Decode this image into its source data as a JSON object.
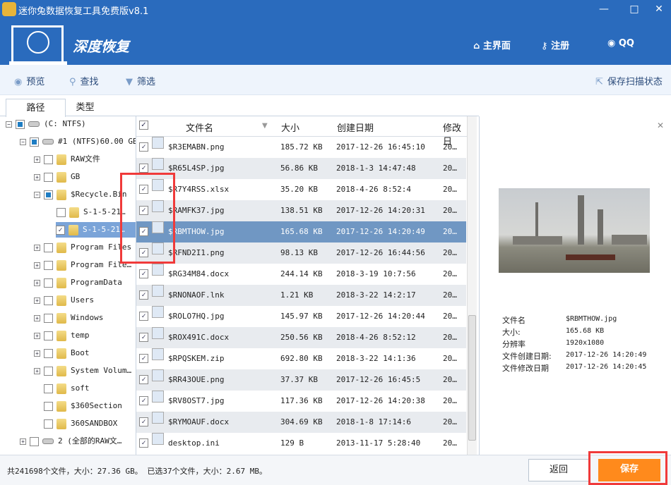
{
  "window": {
    "title": "迷你兔数据恢复工具免费版v8.1",
    "minimize": "—",
    "maximize": "□",
    "close": "✕"
  },
  "header": {
    "mode": "深度恢复",
    "nav": [
      {
        "icon": "home-icon",
        "glyph": "⌂",
        "label": "主界面"
      },
      {
        "icon": "key-icon",
        "glyph": "⚷",
        "label": "注册"
      },
      {
        "icon": "qq-icon",
        "glyph": "◉",
        "label": "QQ"
      }
    ]
  },
  "toolbar": {
    "preview": "预览",
    "find": "查找",
    "filter": "筛选",
    "save_scan": "保存扫描状态"
  },
  "tabs": [
    "路径",
    "类型"
  ],
  "tree": [
    {
      "label": "(C: NTFS)",
      "level": 0,
      "pm": "−",
      "cb": "part",
      "icon": "drive"
    },
    {
      "label": "#1 (NTFS)60.00 GB",
      "level": 1,
      "pm": "−",
      "cb": "part",
      "icon": "drive"
    },
    {
      "label": "RAW文件",
      "level": 2,
      "pm": "+",
      "cb": "",
      "icon": "folder"
    },
    {
      "label": "GB",
      "level": 2,
      "pm": "+",
      "cb": "",
      "icon": "folder"
    },
    {
      "label": "$Recycle.Bin",
      "level": 2,
      "pm": "−",
      "cb": "part",
      "icon": "folder"
    },
    {
      "label": "S-1-5-21…",
      "level": 3,
      "pm": "",
      "cb": "",
      "icon": "folder"
    },
    {
      "label": "S-1-5-21…",
      "level": 3,
      "pm": "",
      "cb": "✓",
      "icon": "folder",
      "selected": true
    },
    {
      "label": "Program Files",
      "level": 2,
      "pm": "+",
      "cb": "",
      "icon": "folder"
    },
    {
      "label": "Program File…",
      "level": 2,
      "pm": "+",
      "cb": "",
      "icon": "folder"
    },
    {
      "label": "ProgramData",
      "level": 2,
      "pm": "+",
      "cb": "",
      "icon": "folder"
    },
    {
      "label": "Users",
      "level": 2,
      "pm": "+",
      "cb": "",
      "icon": "folder"
    },
    {
      "label": "Windows",
      "level": 2,
      "pm": "+",
      "cb": "",
      "icon": "folder"
    },
    {
      "label": "temp",
      "level": 2,
      "pm": "+",
      "cb": "",
      "icon": "folder"
    },
    {
      "label": "Boot",
      "level": 2,
      "pm": "+",
      "cb": "",
      "icon": "folder"
    },
    {
      "label": "System Volum…",
      "level": 2,
      "pm": "+",
      "cb": "",
      "icon": "folder"
    },
    {
      "label": "soft",
      "level": 2,
      "pm": "",
      "cb": "",
      "icon": "folder"
    },
    {
      "label": "$360Section",
      "level": 2,
      "pm": "",
      "cb": "",
      "icon": "folder"
    },
    {
      "label": "360SANDBOX",
      "level": 2,
      "pm": "",
      "cb": "",
      "icon": "folder"
    },
    {
      "label": "2 (全部的RAW文…",
      "level": 1,
      "pm": "+",
      "cb": "",
      "icon": "drive"
    }
  ],
  "list": {
    "columns": [
      "文件名",
      "大小",
      "创建日期",
      "修改日"
    ],
    "rows": [
      {
        "name": "$R3EMABN.png",
        "size": "185.72 KB",
        "created": "2017-12-26 16:45:10",
        "modified": "20…"
      },
      {
        "name": "$R65L4SP.jpg",
        "size": "56.86 KB",
        "created": "2018-1-3 14:47:48",
        "modified": "20…"
      },
      {
        "name": "$R7Y4RSS.xlsx",
        "size": "35.20 KB",
        "created": "2018-4-26 8:52:4",
        "modified": "20…"
      },
      {
        "name": "$RAMFK37.jpg",
        "size": "138.51 KB",
        "created": "2017-12-26 14:20:31",
        "modified": "20…"
      },
      {
        "name": "$RBMTHOW.jpg",
        "size": "165.68 KB",
        "created": "2017-12-26 14:20:49",
        "modified": "20…"
      },
      {
        "name": "$RFND2I1.png",
        "size": "98.13 KB",
        "created": "2017-12-26 16:44:56",
        "modified": "20…"
      },
      {
        "name": "$RG34M84.docx",
        "size": "244.14 KB",
        "created": "2018-3-19 10:7:56",
        "modified": "20…"
      },
      {
        "name": "$RNONAOF.lnk",
        "size": "1.21 KB",
        "created": "2018-3-22 14:2:17",
        "modified": "20…"
      },
      {
        "name": "$ROLO7HQ.jpg",
        "size": "145.97 KB",
        "created": "2017-12-26 14:20:44",
        "modified": "20…"
      },
      {
        "name": "$ROX491C.docx",
        "size": "250.56 KB",
        "created": "2018-4-26 8:52:12",
        "modified": "20…"
      },
      {
        "name": "$RPQSKEM.zip",
        "size": "692.80 KB",
        "created": "2018-3-22 14:1:36",
        "modified": "20…"
      },
      {
        "name": "$RR43OUE.png",
        "size": "37.37 KB",
        "created": "2017-12-26 16:45:5",
        "modified": "20…"
      },
      {
        "name": "$RV8OST7.jpg",
        "size": "117.36 KB",
        "created": "2017-12-26 14:20:38",
        "modified": "20…"
      },
      {
        "name": "$RYMOAUF.docx",
        "size": "304.69 KB",
        "created": "2018-1-8 17:14:6",
        "modified": "20…"
      },
      {
        "name": "desktop.ini",
        "size": "129 B",
        "created": "2013-11-17 5:28:40",
        "modified": "20…"
      }
    ]
  },
  "preview": {
    "close": "✕",
    "info": [
      {
        "label": "文件名",
        "value": "$RBMTHOW.jpg"
      },
      {
        "label": "大小:",
        "value": "165.68 KB"
      },
      {
        "label": "分辨率",
        "value": "1920x1080"
      },
      {
        "label": "文件创建日期:",
        "value": "2017-12-26 14:20:49"
      },
      {
        "label": "文件修改日期",
        "value": "2017-12-26 14:20:45"
      }
    ]
  },
  "footer": {
    "status": "共241698个文件，大小：27.36 GB。 已选37个文件，大小：2.67 MB。",
    "back": "返回",
    "save": "保存"
  },
  "colors": {
    "header": "#2a6bbd",
    "selected_row": "#7097c3",
    "save": "#ff8a1c",
    "annotation": "#f03a3a"
  }
}
